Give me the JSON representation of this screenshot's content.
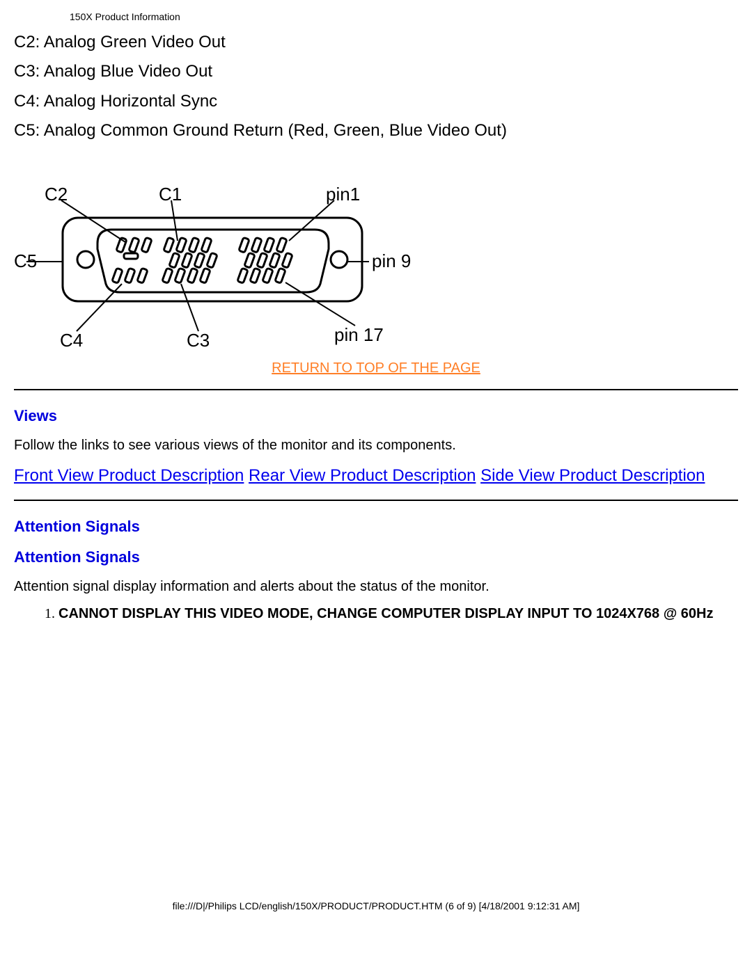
{
  "header": {
    "title": "150X Product Information"
  },
  "pins": {
    "c2": "C2: Analog Green Video Out",
    "c3": "C3: Analog Blue Video Out",
    "c4": "C4: Analog Horizontal Sync",
    "c5": "C5: Analog Common Ground Return (Red, Green, Blue Video Out)"
  },
  "diagram": {
    "labels": {
      "c1": "C1",
      "c2": "C2",
      "c3": "C3",
      "c4": "C4",
      "c5": "C5",
      "pin1": "pin1",
      "pin9": "pin 9",
      "pin17": "pin 17"
    }
  },
  "return_link": "RETURN TO TOP OF THE PAGE",
  "views": {
    "heading": "Views",
    "intro": "Follow the links to see various views of the monitor and its components.",
    "links": {
      "front": "Front View Product Description",
      "rear": "Rear View Product Description",
      "side": "Side View Product Description"
    }
  },
  "attention": {
    "heading1": "Attention Signals",
    "heading2": "Attention Signals",
    "intro": "Attention signal display information and alerts about the status of the monitor.",
    "item1": "CANNOT DISPLAY THIS VIDEO MODE, CHANGE COMPUTER DISPLAY INPUT TO 1024X768 @ 60Hz"
  },
  "footer": {
    "text": "file:///D|/Philips LCD/english/150X/PRODUCT/PRODUCT.HTM (6 of 9) [4/18/2001 9:12:31 AM]"
  }
}
